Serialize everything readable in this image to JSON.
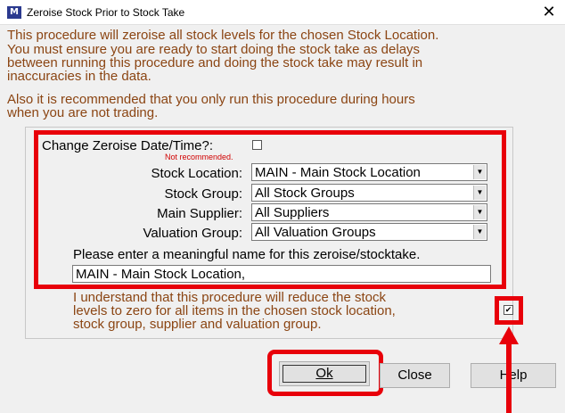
{
  "window": {
    "title": "Zeroise Stock Prior to Stock Take",
    "icon": "app-logo-icon",
    "close": "✕"
  },
  "intro": {
    "lines": [
      "This procedure will zeroise all stock levels for the chosen Stock Location.",
      "You must ensure you are ready to start doing the stock take as delays",
      "between running this procedure and doing the stock take may result in",
      "inaccuracies in the data."
    ],
    "note_lines": [
      "Also it is recommended that you only run this procedure during hours",
      "when you are not trading."
    ]
  },
  "form": {
    "change_date_label": "Change Zeroise Date/Time?:",
    "change_date_checked": false,
    "not_recommended": "Not recommended.",
    "stock_location_label": "Stock Location:",
    "stock_location_value": "MAIN - Main Stock Location",
    "stock_group_label": "Stock Group:",
    "stock_group_value": "All Stock Groups",
    "main_supplier_label": "Main Supplier:",
    "main_supplier_value": "All Suppliers",
    "valuation_group_label": "Valuation Group:",
    "valuation_group_value": "All Valuation Groups",
    "name_prompt": "Please enter a meaningful name for this zeroise/stocktake.",
    "name_value": "MAIN - Main Stock Location,"
  },
  "confirm": {
    "lines": [
      "I understand that this procedure will reduce the stock",
      "levels to zero for all items in the chosen stock location,",
      "stock group, supplier and valuation group."
    ],
    "checked": true
  },
  "buttons": {
    "ok": "Ok",
    "close": "Close",
    "help": "Help"
  },
  "colors": {
    "highlight": "#e8000a",
    "body_text": "#8b4513"
  }
}
